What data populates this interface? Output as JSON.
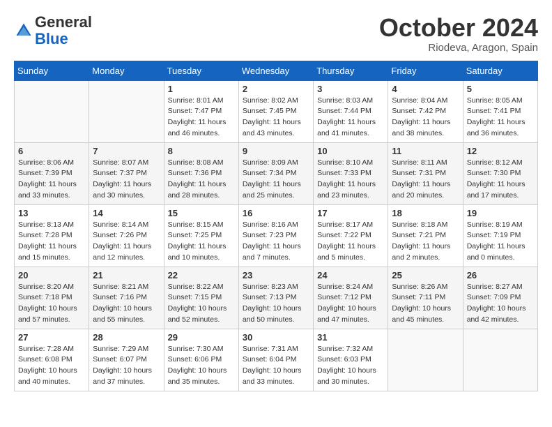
{
  "header": {
    "logo_general": "General",
    "logo_blue": "Blue",
    "month_title": "October 2024",
    "location": "Riodeva, Aragon, Spain"
  },
  "weekdays": [
    "Sunday",
    "Monday",
    "Tuesday",
    "Wednesday",
    "Thursday",
    "Friday",
    "Saturday"
  ],
  "weeks": [
    [
      {
        "day": "",
        "info": ""
      },
      {
        "day": "",
        "info": ""
      },
      {
        "day": "1",
        "info": "Sunrise: 8:01 AM\nSunset: 7:47 PM\nDaylight: 11 hours and 46 minutes."
      },
      {
        "day": "2",
        "info": "Sunrise: 8:02 AM\nSunset: 7:45 PM\nDaylight: 11 hours and 43 minutes."
      },
      {
        "day": "3",
        "info": "Sunrise: 8:03 AM\nSunset: 7:44 PM\nDaylight: 11 hours and 41 minutes."
      },
      {
        "day": "4",
        "info": "Sunrise: 8:04 AM\nSunset: 7:42 PM\nDaylight: 11 hours and 38 minutes."
      },
      {
        "day": "5",
        "info": "Sunrise: 8:05 AM\nSunset: 7:41 PM\nDaylight: 11 hours and 36 minutes."
      }
    ],
    [
      {
        "day": "6",
        "info": "Sunrise: 8:06 AM\nSunset: 7:39 PM\nDaylight: 11 hours and 33 minutes."
      },
      {
        "day": "7",
        "info": "Sunrise: 8:07 AM\nSunset: 7:37 PM\nDaylight: 11 hours and 30 minutes."
      },
      {
        "day": "8",
        "info": "Sunrise: 8:08 AM\nSunset: 7:36 PM\nDaylight: 11 hours and 28 minutes."
      },
      {
        "day": "9",
        "info": "Sunrise: 8:09 AM\nSunset: 7:34 PM\nDaylight: 11 hours and 25 minutes."
      },
      {
        "day": "10",
        "info": "Sunrise: 8:10 AM\nSunset: 7:33 PM\nDaylight: 11 hours and 23 minutes."
      },
      {
        "day": "11",
        "info": "Sunrise: 8:11 AM\nSunset: 7:31 PM\nDaylight: 11 hours and 20 minutes."
      },
      {
        "day": "12",
        "info": "Sunrise: 8:12 AM\nSunset: 7:30 PM\nDaylight: 11 hours and 17 minutes."
      }
    ],
    [
      {
        "day": "13",
        "info": "Sunrise: 8:13 AM\nSunset: 7:28 PM\nDaylight: 11 hours and 15 minutes."
      },
      {
        "day": "14",
        "info": "Sunrise: 8:14 AM\nSunset: 7:26 PM\nDaylight: 11 hours and 12 minutes."
      },
      {
        "day": "15",
        "info": "Sunrise: 8:15 AM\nSunset: 7:25 PM\nDaylight: 11 hours and 10 minutes."
      },
      {
        "day": "16",
        "info": "Sunrise: 8:16 AM\nSunset: 7:23 PM\nDaylight: 11 hours and 7 minutes."
      },
      {
        "day": "17",
        "info": "Sunrise: 8:17 AM\nSunset: 7:22 PM\nDaylight: 11 hours and 5 minutes."
      },
      {
        "day": "18",
        "info": "Sunrise: 8:18 AM\nSunset: 7:21 PM\nDaylight: 11 hours and 2 minutes."
      },
      {
        "day": "19",
        "info": "Sunrise: 8:19 AM\nSunset: 7:19 PM\nDaylight: 11 hours and 0 minutes."
      }
    ],
    [
      {
        "day": "20",
        "info": "Sunrise: 8:20 AM\nSunset: 7:18 PM\nDaylight: 10 hours and 57 minutes."
      },
      {
        "day": "21",
        "info": "Sunrise: 8:21 AM\nSunset: 7:16 PM\nDaylight: 10 hours and 55 minutes."
      },
      {
        "day": "22",
        "info": "Sunrise: 8:22 AM\nSunset: 7:15 PM\nDaylight: 10 hours and 52 minutes."
      },
      {
        "day": "23",
        "info": "Sunrise: 8:23 AM\nSunset: 7:13 PM\nDaylight: 10 hours and 50 minutes."
      },
      {
        "day": "24",
        "info": "Sunrise: 8:24 AM\nSunset: 7:12 PM\nDaylight: 10 hours and 47 minutes."
      },
      {
        "day": "25",
        "info": "Sunrise: 8:26 AM\nSunset: 7:11 PM\nDaylight: 10 hours and 45 minutes."
      },
      {
        "day": "26",
        "info": "Sunrise: 8:27 AM\nSunset: 7:09 PM\nDaylight: 10 hours and 42 minutes."
      }
    ],
    [
      {
        "day": "27",
        "info": "Sunrise: 7:28 AM\nSunset: 6:08 PM\nDaylight: 10 hours and 40 minutes."
      },
      {
        "day": "28",
        "info": "Sunrise: 7:29 AM\nSunset: 6:07 PM\nDaylight: 10 hours and 37 minutes."
      },
      {
        "day": "29",
        "info": "Sunrise: 7:30 AM\nSunset: 6:06 PM\nDaylight: 10 hours and 35 minutes."
      },
      {
        "day": "30",
        "info": "Sunrise: 7:31 AM\nSunset: 6:04 PM\nDaylight: 10 hours and 33 minutes."
      },
      {
        "day": "31",
        "info": "Sunrise: 7:32 AM\nSunset: 6:03 PM\nDaylight: 10 hours and 30 minutes."
      },
      {
        "day": "",
        "info": ""
      },
      {
        "day": "",
        "info": ""
      }
    ]
  ]
}
